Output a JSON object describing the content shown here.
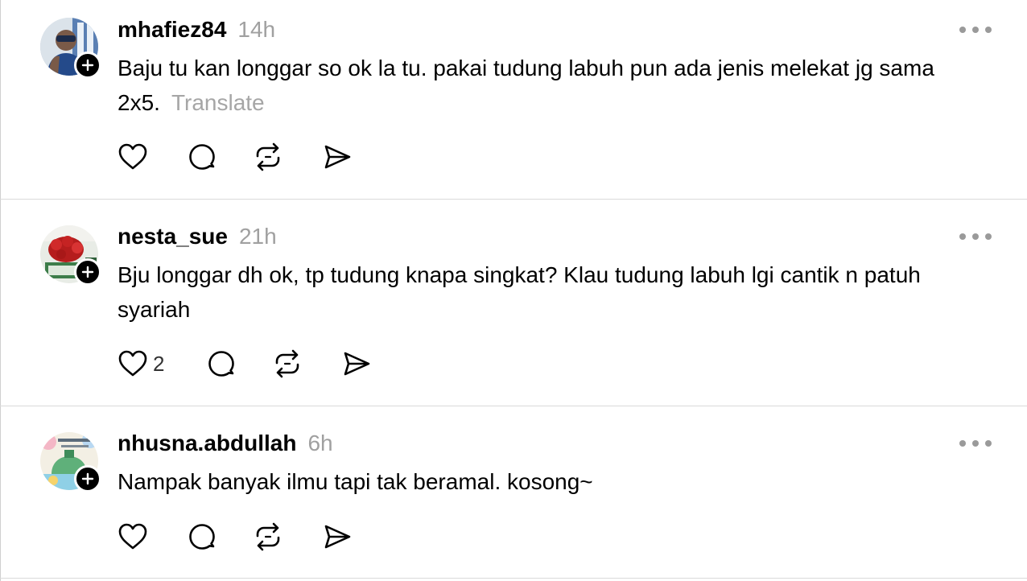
{
  "posts": [
    {
      "username": "mhafiez84",
      "time": "14h",
      "text": "Baju tu kan longgar so ok la tu. pakai tudung labuh pun ada jenis melekat jg sama 2x5.",
      "translate": "Translate",
      "like_count": ""
    },
    {
      "username": "nesta_sue",
      "time": "21h",
      "text": "Bju longgar dh ok, tp tudung knapa singkat? Klau tudung labuh lgi cantik n patuh syariah",
      "translate": "",
      "like_count": "2"
    },
    {
      "username": "nhusna.abdullah",
      "time": "6h",
      "text": "Nampak banyak ilmu tapi tak beramal. kosong~",
      "translate": "",
      "like_count": ""
    }
  ],
  "icons": {
    "like": "heart-icon",
    "reply": "speech-bubble-icon",
    "repost": "repost-icon",
    "share": "paper-plane-icon",
    "more": "more-horizontal-icon",
    "follow": "plus-icon"
  },
  "colors": {
    "text": "#000000",
    "muted": "#a0a0a0",
    "divider": "#dadada",
    "badge": "#000000"
  }
}
